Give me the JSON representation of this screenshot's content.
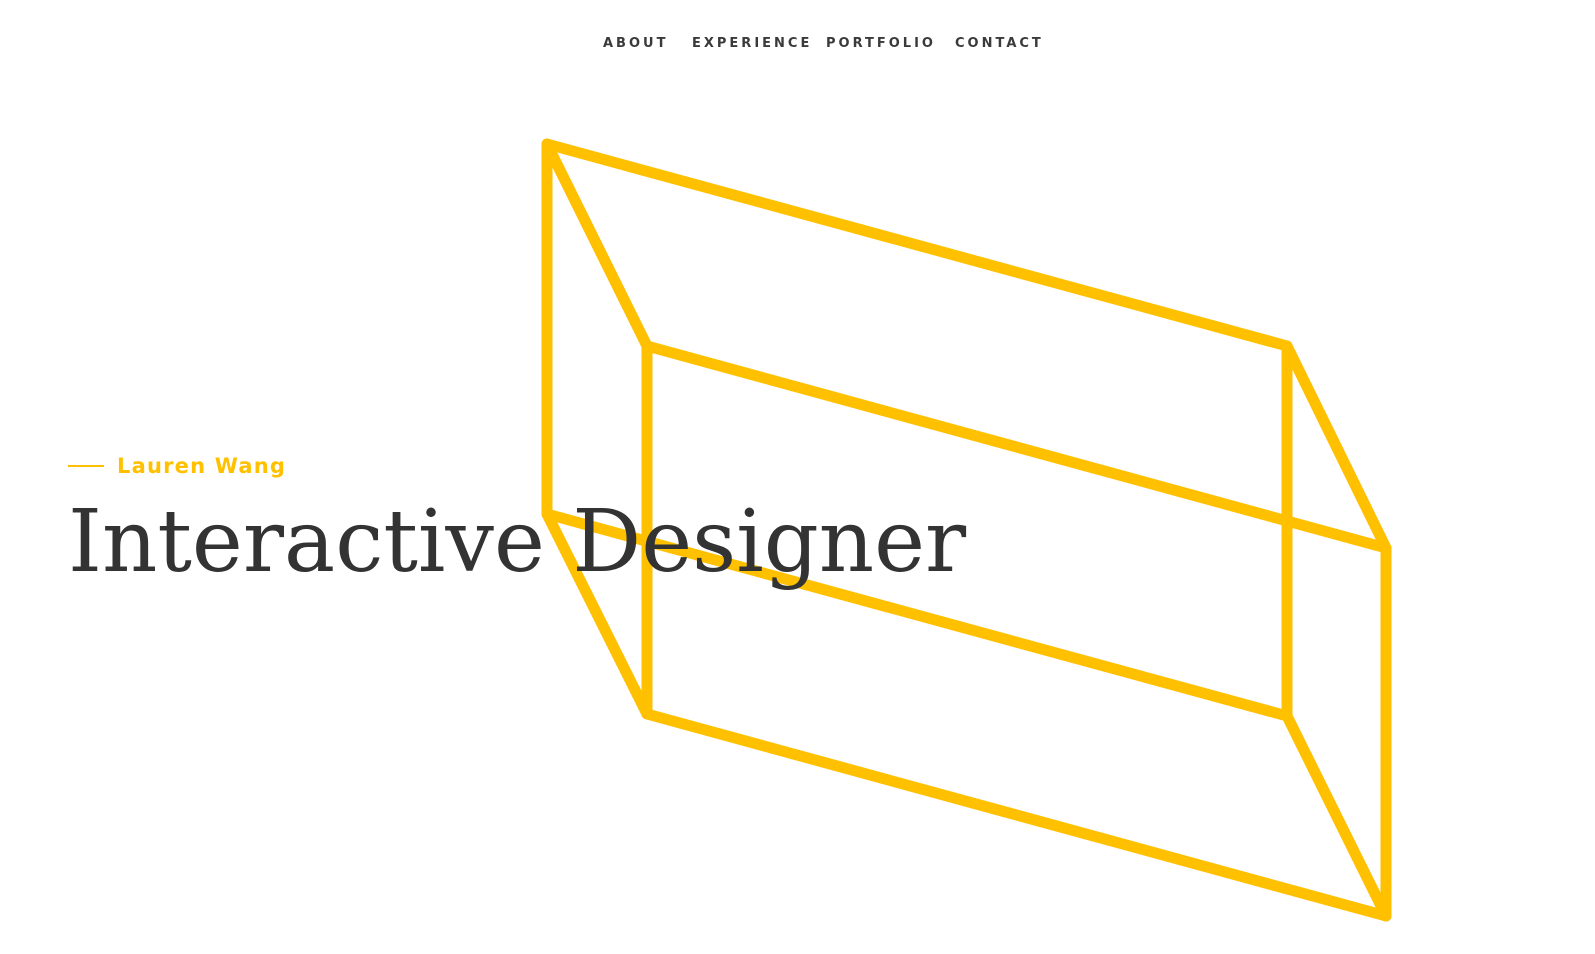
{
  "nav": {
    "items": [
      {
        "label": "ABOUT"
      },
      {
        "label": "EXPERIENCE"
      },
      {
        "label": "PORTFOLIO"
      },
      {
        "label": "CONTACT"
      }
    ]
  },
  "hero": {
    "name": "Lauren Wang",
    "headline": "Interactive Designer"
  },
  "colors": {
    "accent": "#ffc000",
    "text": "#333333",
    "nav_text": "#3a3a3a",
    "background": "#ffffff"
  }
}
